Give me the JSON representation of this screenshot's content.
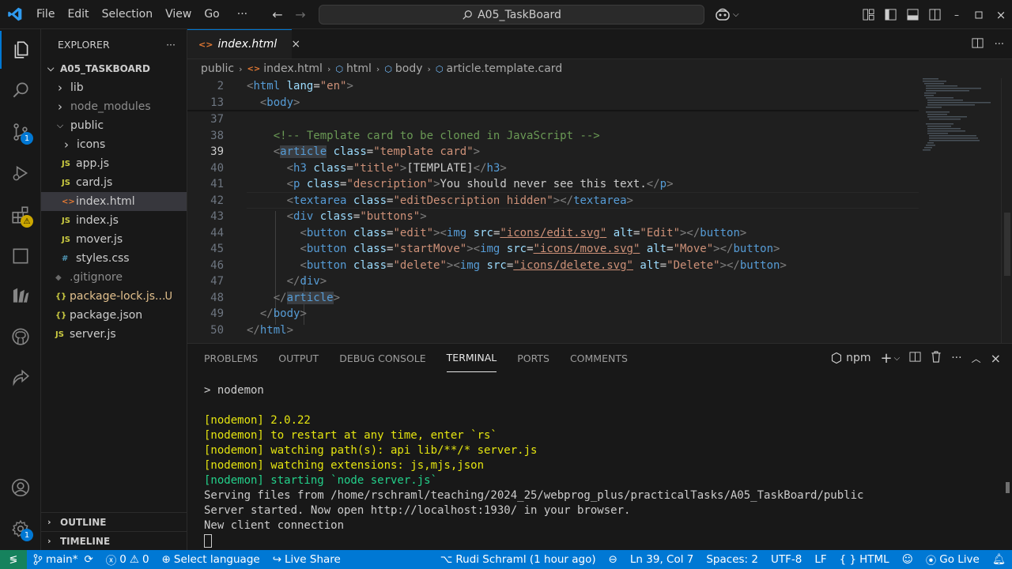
{
  "titlebar": {
    "menus": [
      "File",
      "Edit",
      "Selection",
      "View",
      "Go"
    ],
    "more": "···",
    "search_text": "A05_TaskBoard"
  },
  "activity": {
    "scm_badge": "1",
    "extensions_badge": "⚠",
    "settings_badge": "1"
  },
  "sidebar": {
    "title": "EXPLORER",
    "more": "···",
    "root": "A05_TASKBOARD",
    "items": [
      {
        "label": "lib",
        "type": "folder",
        "depth": 1,
        "expanded": false
      },
      {
        "label": "node_modules",
        "type": "folder",
        "depth": 1,
        "expanded": false,
        "dim": true
      },
      {
        "label": "public",
        "type": "folder",
        "depth": 1,
        "expanded": true
      },
      {
        "label": "icons",
        "type": "folder",
        "depth": 2,
        "expanded": false
      },
      {
        "label": "app.js",
        "type": "js",
        "depth": 2
      },
      {
        "label": "card.js",
        "type": "js",
        "depth": 2
      },
      {
        "label": "index.html",
        "type": "html",
        "depth": 2,
        "selected": true
      },
      {
        "label": "index.js",
        "type": "js",
        "depth": 2
      },
      {
        "label": "mover.js",
        "type": "js",
        "depth": 2
      },
      {
        "label": "styles.css",
        "type": "css",
        "depth": 2
      },
      {
        "label": ".gitignore",
        "type": "git",
        "depth": 1,
        "dim": true
      },
      {
        "label": "package-lock.js...",
        "type": "json",
        "depth": 1,
        "modified": true,
        "mod": "U"
      },
      {
        "label": "package.json",
        "type": "json",
        "depth": 1
      },
      {
        "label": "server.js",
        "type": "js",
        "depth": 1
      }
    ],
    "outline": "OUTLINE",
    "timeline": "TIMELINE"
  },
  "editor": {
    "tab_label": "index.html",
    "tab_close": "×",
    "breadcrumb": [
      "public",
      "index.html",
      "html",
      "body",
      "article.template.card"
    ],
    "line_numbers": [
      "2",
      "13",
      "37",
      "38",
      "39",
      "40",
      "41",
      "42",
      "43",
      "44",
      "45",
      "46",
      "47",
      "48",
      "49",
      "50"
    ],
    "code": {
      "l2": {
        "tag": "html",
        "attr": "lang",
        "val": "\"en\""
      },
      "l13": {
        "tag": "body"
      },
      "l38": {
        "comment": "<!-- Template card to be cloned in JavaScript -->"
      },
      "l39": {
        "tag": "article",
        "attr": "class",
        "val": "\"template card\""
      },
      "l40": {
        "tag": "h3",
        "attr": "class",
        "val": "\"title\"",
        "text": "[TEMPLATE]"
      },
      "l41": {
        "tag": "p",
        "attr": "class",
        "val": "\"description\"",
        "text": "You should never see this text."
      },
      "l42": {
        "tag": "textarea",
        "attr": "class",
        "val": "\"editDescription hidden\""
      },
      "l43": {
        "tag": "div",
        "attr": "class",
        "val": "\"buttons\""
      },
      "l44": {
        "tag": "button",
        "attr": "class",
        "val": "\"edit\"",
        "tag2": "img",
        "attr2": "src",
        "val2": "\"icons/edit.svg\"",
        "attr3": "alt",
        "val3": "\"Edit\""
      },
      "l45": {
        "tag": "button",
        "attr": "class",
        "val": "\"startMove\"",
        "tag2": "img",
        "attr2": "src",
        "val2": "\"icons/move.svg\"",
        "attr3": "alt",
        "val3": "\"Move\""
      },
      "l46": {
        "tag": "button",
        "attr": "class",
        "val": "\"delete\"",
        "tag2": "img",
        "attr2": "src",
        "val2": "\"icons/delete.svg\"",
        "attr3": "alt",
        "val3": "\"Delete\""
      },
      "l47": {
        "tag": "div"
      },
      "l48": {
        "tag": "article"
      },
      "l49": {
        "tag": "body"
      },
      "l50": {
        "tag": "html"
      }
    }
  },
  "panel": {
    "tabs": [
      "PROBLEMS",
      "OUTPUT",
      "DEBUG CONSOLE",
      "TERMINAL",
      "PORTS",
      "COMMENTS"
    ],
    "active_tab": "TERMINAL",
    "terminal_name": "npm",
    "terminal": [
      {
        "text": "> nodemon",
        "color": "white"
      },
      {
        "text": "",
        "color": "white"
      },
      {
        "text": "[nodemon] 2.0.22",
        "color": "yellow"
      },
      {
        "text": "[nodemon] to restart at any time, enter `rs`",
        "color": "yellow"
      },
      {
        "text": "[nodemon] watching path(s): api lib/**/* server.js",
        "color": "yellow"
      },
      {
        "text": "[nodemon] watching extensions: js,mjs,json",
        "color": "yellow"
      },
      {
        "text": "[nodemon] starting `node server.js`",
        "color": "green"
      },
      {
        "text": "Serving files from /home/rschraml/teaching/2024_25/webprog_plus/practicalTasks/A05_TaskBoard/public",
        "color": "white"
      },
      {
        "text": "Server started. Now open http://localhost:1930/ in your browser.",
        "color": "white"
      },
      {
        "text": "New client connection",
        "color": "white"
      }
    ]
  },
  "statusbar": {
    "branch": "main*",
    "errors": "0",
    "warnings": "0",
    "language_select": "Select language",
    "live_share": "Live Share",
    "blame": "Rudi Schraml (1 hour ago)",
    "position": "Ln 39, Col 7",
    "spaces": "Spaces: 2",
    "encoding": "UTF-8",
    "eol": "LF",
    "language": "HTML",
    "go_live": "Go Live"
  }
}
